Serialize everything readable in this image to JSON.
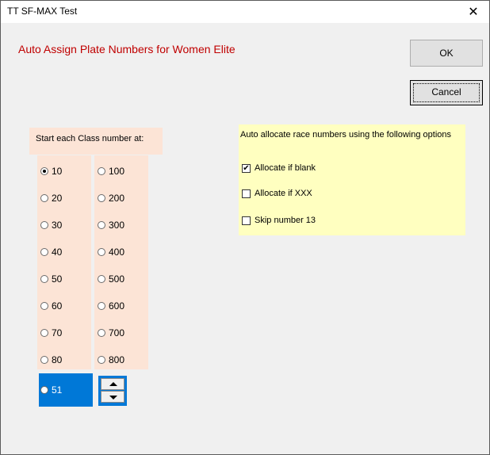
{
  "window": {
    "title": "TT SF-MAX Test",
    "close_glyph": "✕"
  },
  "heading": "Auto Assign Plate Numbers for Women Elite",
  "buttons": {
    "ok": "OK",
    "cancel": "Cancel"
  },
  "class_start": {
    "label": "Start each Class number at:",
    "col1": [
      "10",
      "20",
      "30",
      "40",
      "50",
      "60",
      "70",
      "80"
    ],
    "col2": [
      "100",
      "200",
      "300",
      "400",
      "500",
      "600",
      "700",
      "800"
    ],
    "selected": "10",
    "custom_value": "51"
  },
  "auto_allocate": {
    "label": "Auto allocate race numbers using the following options",
    "options": [
      {
        "label": "Allocate if blank",
        "checked": true
      },
      {
        "label": "Allocate if XXX",
        "checked": false
      },
      {
        "label": "Skip number 13",
        "checked": false
      }
    ]
  },
  "colors": {
    "heading": "#c00000",
    "left_panel": "#fce4d6",
    "right_panel": "#ffffc0",
    "selection": "#0078d7"
  }
}
